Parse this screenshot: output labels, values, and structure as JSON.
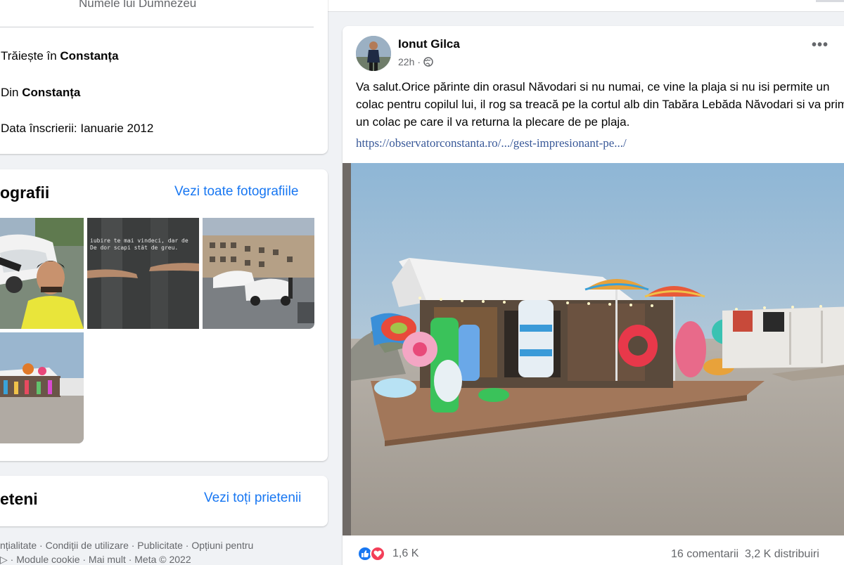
{
  "intro": {
    "cut_text": "Numele lui Dumnezeu",
    "lives_prefix": "Trăiește în ",
    "lives_city": "Constanța",
    "from_prefix": "Din ",
    "from_city": "Constanța",
    "joined": "Data înscrierii: Ianuarie 2012"
  },
  "photos": {
    "title": "ografii",
    "see_all": "Vezi toate fotografiile",
    "thumb2_text_line1": "iubire te mai vindeci, dar de",
    "thumb2_text_line2": "De dor scapi stăt de greu."
  },
  "friends": {
    "title": "eteni",
    "see_all": "Vezi toți prietenii"
  },
  "footer": {
    "line1": "nțialitate · Condiții de utilizare · Publicitate · Opțiuni pentru",
    "line2": "▷ · Module cookie · Mai mult · Meta © 2022"
  },
  "post": {
    "author": "Ionut Gilca",
    "time": "22h",
    "audience_icon": "globe-icon",
    "more_label": "•••",
    "text": "Va salut.Orice părinte din orasul Năvodari si nu numai, ce vine la plaja si nu isi permite un colac pentru copilul lui, il rog sa treacă pe la cortul alb din Tabăra Lebăda Năvodari si va primi un colac pe care il va returna la plecare de pe plaja.",
    "link": "https://observatorconstanta.ro/.../gest-impresionant-pe.../",
    "reaction_count": "1,6 K",
    "comments": "16 comentarii",
    "shares": "3,2 K distribuiri"
  },
  "colors": {
    "link_blue": "#1877f2",
    "secondary_text": "#65676b",
    "background": "#f0f2f5",
    "like_blue": "#1877f2",
    "love_red": "#f33e58"
  }
}
